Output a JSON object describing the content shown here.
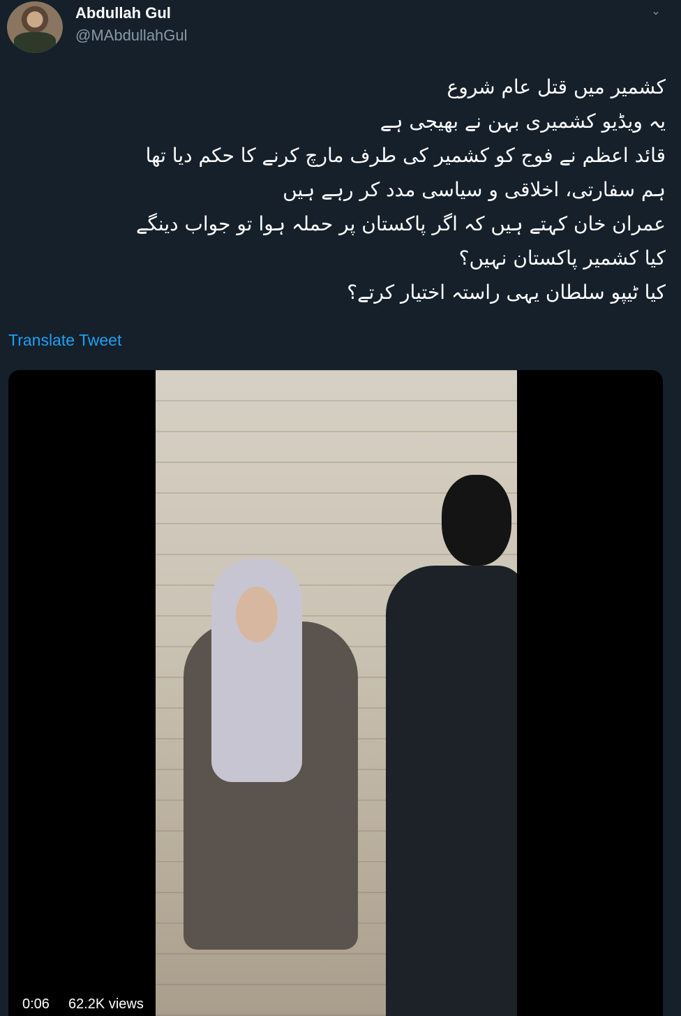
{
  "author": {
    "display_name": "Abdullah Gul",
    "handle": "@MAbdullahGul"
  },
  "menu_icon": "chevron-down-icon",
  "tweet": {
    "lines": [
      "کشمیر میں قتل عام شروع",
      "یہ ویڈیو  کشمیری بہن نے بھیجی ہے",
      "قائد اعظم نے فوج کو کشمیر کی طرف مارچ کرنے کا حکم دیا تھا",
      "ہم سفارتی، اخلاقی و سیاسی مدد کر رہے ہیں",
      "عمران خان کہتے ہیں کہ اگر پاکستان پر حملہ ہوا تو جواب دینگے",
      "کیا کشمیر پاکستان نہیں؟",
      "کیا ٹیپو سلطان یہی راستہ اختیار کرتے؟"
    ],
    "translate_label": "Translate Tweet"
  },
  "video": {
    "elapsed": "0:06",
    "views": "62.2K views"
  },
  "colors": {
    "background": "#15202b",
    "accent": "#1da1f2",
    "muted": "#8899a6"
  }
}
